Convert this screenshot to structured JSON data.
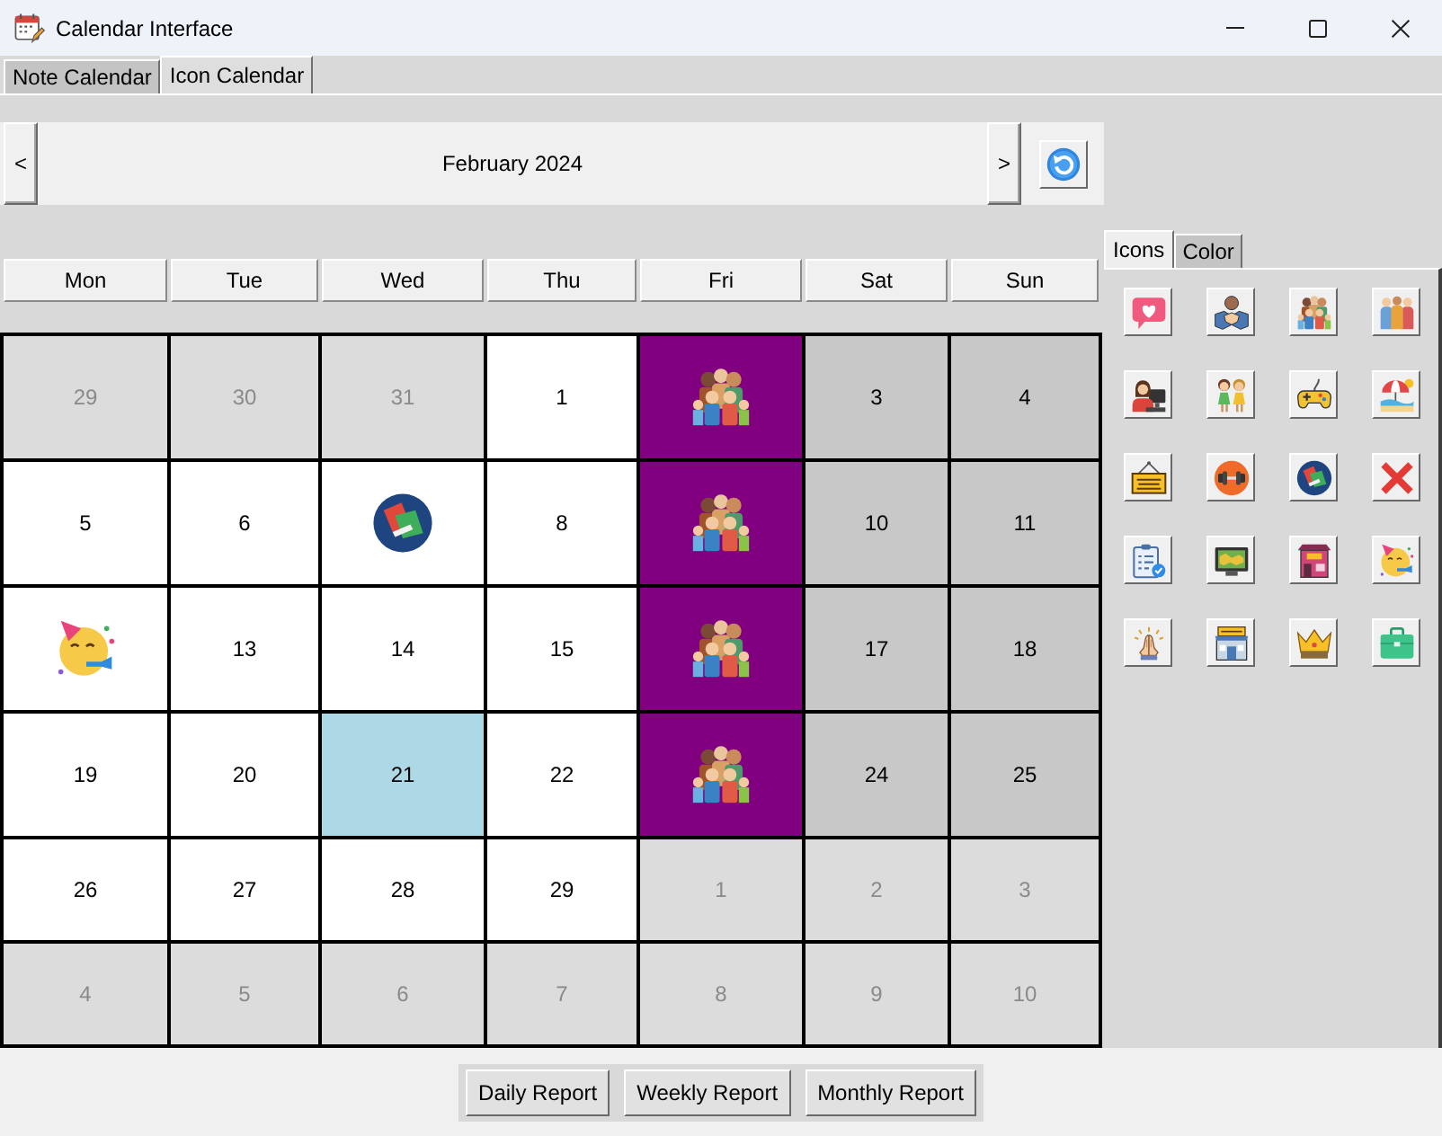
{
  "window": {
    "title": "Calendar Interface"
  },
  "tabs": [
    {
      "label": "Note Calendar",
      "selected": false
    },
    {
      "label": "Icon Calendar",
      "selected": true
    }
  ],
  "navigation": {
    "previous": "<",
    "month": "February 2024",
    "next": ">"
  },
  "calendar": {
    "weekdays": [
      "Mon",
      "Tue",
      "Wed",
      "Thu",
      "Fri",
      "Sat",
      "Sun"
    ],
    "weeks": [
      [
        {
          "kind": "date",
          "day": "29",
          "in_month": false,
          "color": "#dcdcdc"
        },
        {
          "kind": "date",
          "day": "30",
          "in_month": false,
          "color": "#dcdcdc"
        },
        {
          "kind": "date",
          "day": "31",
          "in_month": false,
          "color": "#dcdcdc"
        },
        {
          "kind": "date",
          "day": "1",
          "in_month": true,
          "color": "#ffffff"
        },
        {
          "kind": "family",
          "color": "#800080"
        },
        {
          "kind": "date",
          "day": "3",
          "in_month": true,
          "color": "#c8c8c8"
        },
        {
          "kind": "date",
          "day": "4",
          "in_month": true,
          "color": "#c8c8c8"
        }
      ],
      [
        {
          "kind": "date",
          "day": "5",
          "in_month": true,
          "color": "#ffffff"
        },
        {
          "kind": "date",
          "day": "6",
          "in_month": true,
          "color": "#ffffff"
        },
        {
          "kind": "books",
          "color": "#ffffff"
        },
        {
          "kind": "date",
          "day": "8",
          "in_month": true,
          "color": "#ffffff"
        },
        {
          "kind": "family",
          "color": "#800080"
        },
        {
          "kind": "date",
          "day": "10",
          "in_month": true,
          "color": "#c8c8c8"
        },
        {
          "kind": "date",
          "day": "11",
          "in_month": true,
          "color": "#c8c8c8"
        }
      ],
      [
        {
          "kind": "party",
          "color": "#ffffff"
        },
        {
          "kind": "date",
          "day": "13",
          "in_month": true,
          "color": "#ffffff"
        },
        {
          "kind": "date",
          "day": "14",
          "in_month": true,
          "color": "#ffffff"
        },
        {
          "kind": "date",
          "day": "15",
          "in_month": true,
          "color": "#ffffff"
        },
        {
          "kind": "family",
          "color": "#800080"
        },
        {
          "kind": "date",
          "day": "17",
          "in_month": true,
          "color": "#c8c8c8"
        },
        {
          "kind": "date",
          "day": "18",
          "in_month": true,
          "color": "#c8c8c8"
        }
      ],
      [
        {
          "kind": "date",
          "day": "19",
          "in_month": true,
          "color": "#ffffff"
        },
        {
          "kind": "date",
          "day": "20",
          "in_month": true,
          "color": "#ffffff"
        },
        {
          "kind": "date",
          "day": "21",
          "in_month": true,
          "color": "#add8e6"
        },
        {
          "kind": "date",
          "day": "22",
          "in_month": true,
          "color": "#ffffff"
        },
        {
          "kind": "family",
          "color": "#800080"
        },
        {
          "kind": "date",
          "day": "24",
          "in_month": true,
          "color": "#c8c8c8"
        },
        {
          "kind": "date",
          "day": "25",
          "in_month": true,
          "color": "#c8c8c8"
        }
      ],
      [
        {
          "kind": "date",
          "day": "26",
          "in_month": true,
          "color": "#ffffff"
        },
        {
          "kind": "date",
          "day": "27",
          "in_month": true,
          "color": "#ffffff"
        },
        {
          "kind": "date",
          "day": "28",
          "in_month": true,
          "color": "#ffffff"
        },
        {
          "kind": "date",
          "day": "29",
          "in_month": true,
          "color": "#ffffff"
        },
        {
          "kind": "date",
          "day": "1",
          "in_month": false,
          "color": "#dcdcdc"
        },
        {
          "kind": "date",
          "day": "2",
          "in_month": false,
          "color": "#dcdcdc"
        },
        {
          "kind": "date",
          "day": "3",
          "in_month": false,
          "color": "#dcdcdc"
        }
      ],
      [
        {
          "kind": "date",
          "day": "4",
          "in_month": false,
          "color": "#dcdcdc"
        },
        {
          "kind": "date",
          "day": "5",
          "in_month": false,
          "color": "#dcdcdc"
        },
        {
          "kind": "date",
          "day": "6",
          "in_month": false,
          "color": "#dcdcdc"
        },
        {
          "kind": "date",
          "day": "7",
          "in_month": false,
          "color": "#dcdcdc"
        },
        {
          "kind": "date",
          "day": "8",
          "in_month": false,
          "color": "#dcdcdc"
        },
        {
          "kind": "date",
          "day": "9",
          "in_month": false,
          "color": "#dcdcdc"
        },
        {
          "kind": "date",
          "day": "10",
          "in_month": false,
          "color": "#dcdcdc"
        }
      ]
    ]
  },
  "side_tabs": [
    {
      "label": "Icons",
      "selected": true
    },
    {
      "label": "Color",
      "selected": false
    }
  ],
  "icon_palette": [
    {
      "kind": "heart"
    },
    {
      "kind": "handshake"
    },
    {
      "kind": "family"
    },
    {
      "kind": "team"
    },
    {
      "kind": "worker"
    },
    {
      "kind": "friends"
    },
    {
      "kind": "gamepad"
    },
    {
      "kind": "beach"
    },
    {
      "kind": "sign"
    },
    {
      "kind": "fitness"
    },
    {
      "kind": "books"
    },
    {
      "kind": "cross"
    },
    {
      "kind": "checklist"
    },
    {
      "kind": "monitor"
    },
    {
      "kind": "shop"
    },
    {
      "kind": "party"
    },
    {
      "kind": "praying"
    },
    {
      "kind": "store"
    },
    {
      "kind": "crown"
    },
    {
      "kind": "briefcase"
    }
  ],
  "report_buttons": [
    "Daily Report",
    "Weekly Report",
    "Monthly Report"
  ]
}
